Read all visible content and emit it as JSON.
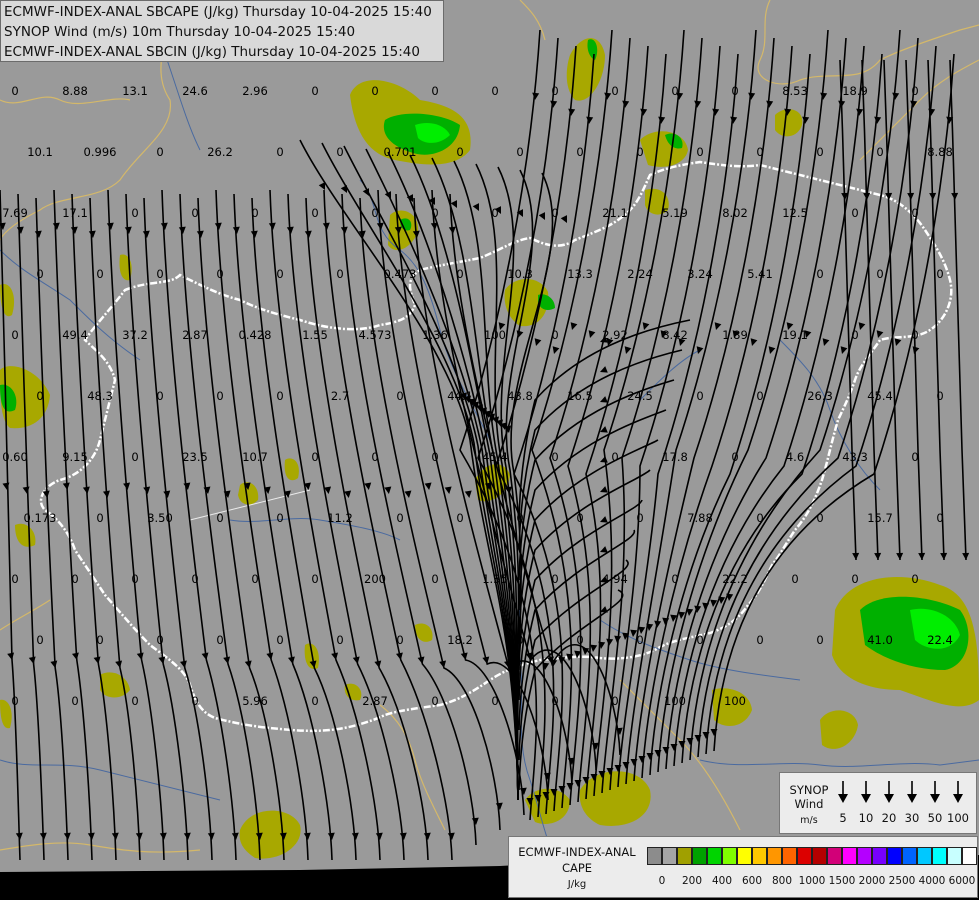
{
  "titles": {
    "line1": "ECMWF-INDEX-ANAL SBCAPE (J/kg) Thursday 10-04-2025 15:40",
    "line2": "SYNOP Wind (m/s) 10m Thursday 10-04-2025 15:40",
    "line3": "ECMWF-INDEX-ANAL SBCIN (J/kg) Thursday 10-04-2025 15:40"
  },
  "colors": {
    "background": "#9a9a9a",
    "cape_low": "#a8a800",
    "cape_green": "#00b000",
    "cape_bright": "#00ee00",
    "border_national": "#ffffff",
    "streamline": "#000000",
    "river": "#4a6aa0",
    "region_border": "#d4b86a"
  },
  "wind_legend": {
    "title_line1": "SYNOP",
    "title_line2": "Wind",
    "unit": "m/s",
    "speeds": [
      "5",
      "10",
      "20",
      "30",
      "50",
      "100"
    ]
  },
  "cape_legend": {
    "title_line1": "ECMWF-INDEX-ANAL",
    "title_line2": "CAPE",
    "unit": "J/kg",
    "colors": [
      "#8c8c8c",
      "#a5a5a5",
      "#a0a000",
      "#00a000",
      "#00d400",
      "#80ff00",
      "#ffff00",
      "#ffc800",
      "#ff9600",
      "#ff6400",
      "#dc0000",
      "#b40000",
      "#d20078",
      "#ff00ff",
      "#b400ff",
      "#7800ff",
      "#0000ff",
      "#0064ff",
      "#00c8ff",
      "#00ffff",
      "#c8ffff",
      "#ffffff"
    ],
    "labels": [
      "0",
      "200",
      "400",
      "600",
      "800",
      "1000",
      "1500",
      "2000",
      "2500",
      "4000",
      "6000"
    ]
  },
  "cin_values": [
    "0",
    "8.88",
    "13.1",
    "24.6",
    "2.96",
    "0",
    "0",
    "0",
    "0",
    "0",
    "0",
    "0",
    "0",
    "8.53",
    "18.9",
    "0",
    "10.1",
    "0.996",
    "0",
    "26.2",
    "0",
    "0",
    "0.701",
    "0",
    "0",
    "0",
    "0",
    "0",
    "0",
    "0",
    "0",
    "8.88",
    "7.69",
    "17.1",
    "0",
    "0",
    "0",
    "0",
    "0",
    "0",
    "0",
    "0",
    "21.1",
    "5.19",
    "8.02",
    "12.5",
    "0",
    "0",
    "0",
    "0",
    "0",
    "0",
    "0",
    "0",
    "0.473",
    "0",
    "10.3",
    "13.3",
    "2.24",
    "3.24",
    "5.41",
    "0",
    "0",
    "0",
    "0",
    "49.4",
    "37.2",
    "2.87",
    "0.428",
    "1.55",
    "4.573",
    "1.36",
    "100",
    "0",
    "2.92",
    "8.42",
    "1.89",
    "19.1",
    "0",
    "0",
    "0",
    "48.3",
    "0",
    "0",
    "0",
    "2.7",
    "0",
    "44.1",
    "43.8",
    "16.5",
    "24.5",
    "0",
    "0",
    "26.3",
    "45.4",
    "0",
    "0.60",
    "9.15",
    "0",
    "23.5",
    "10.7",
    "0",
    "0",
    "0",
    "45.4",
    "0",
    "0",
    "17.8",
    "0",
    "4.6",
    "43.3",
    "0",
    "0.173",
    "0",
    "3.50",
    "0",
    "0",
    "11.2",
    "0",
    "0",
    "0",
    "0",
    "0",
    "7.88",
    "0",
    "0",
    "15.7",
    "0",
    "0",
    "0",
    "0",
    "0",
    "0",
    "0",
    "200",
    "0",
    "1.35",
    "0",
    "4.94",
    "0",
    "22.2",
    "0",
    "0",
    "0",
    "0",
    "0",
    "0",
    "0",
    "0",
    "0",
    "0",
    "18.2",
    "0",
    "0",
    "0",
    "0",
    "0",
    "0",
    "41.0",
    "22.4",
    "0",
    "0",
    "0",
    "0",
    "5.96",
    "0",
    "2.87",
    "0",
    "0",
    "0",
    "0",
    "100",
    "100"
  ]
}
